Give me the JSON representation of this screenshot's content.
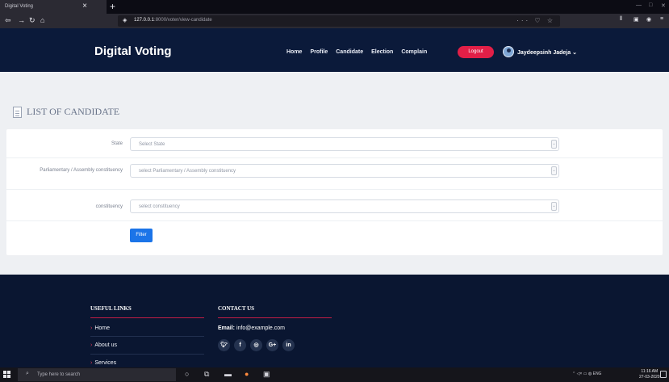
{
  "browser": {
    "tab_title": "Digital Voting",
    "tab_close": "×",
    "new_tab": "+",
    "url_host": "127.0.0.1",
    "url_path": ":8000/voter/view-candidate",
    "url_actions": "··· ♡ ☆"
  },
  "header": {
    "brand": "Digital Voting",
    "menu": [
      "Home",
      "Profile",
      "Candidate",
      "Election",
      "Complain"
    ],
    "logout_label": "Logout",
    "username": "Jaydeepsinh Jadeja"
  },
  "main": {
    "title": "LIST OF CANDIDATE",
    "fields": [
      {
        "label": "State",
        "placeholder": "Select State"
      },
      {
        "label": "Parliamentary / Assembly constituency",
        "placeholder": "select Parliamentary / Assembly constituency"
      },
      {
        "label": "constituency",
        "placeholder": "select constituency"
      }
    ],
    "filter_label": "Filter"
  },
  "footer": {
    "useful_links_heading": "USEFUL LINKS",
    "links": [
      "Home",
      "About us",
      "Services"
    ],
    "contact_heading": "CONTACT US",
    "email_label": "Email:",
    "email_value": "info@example.com",
    "socials": [
      "twitter-icon",
      "facebook-icon",
      "instagram-icon",
      "google-plus-icon",
      "linkedin-icon"
    ]
  },
  "taskbar": {
    "search_placeholder": "Type here to search",
    "tray_lang": "ENG",
    "time": "11:16 AM",
    "date": "27-03-2020"
  },
  "colors": {
    "header_bg": "#0b1a3a",
    "logout_bg": "#e21f47",
    "filter_bg": "#1b74e8",
    "footer_accent": "#c21d45"
  }
}
